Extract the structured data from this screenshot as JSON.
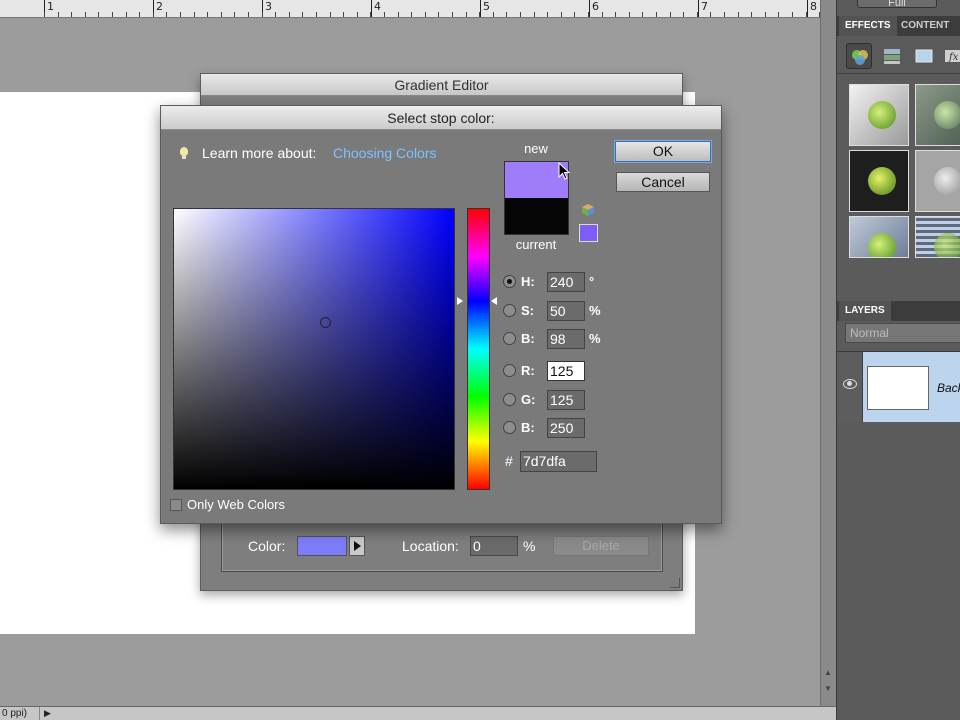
{
  "ruler": {
    "labels": [
      "1",
      "2",
      "3",
      "4",
      "5",
      "6",
      "7",
      "8"
    ]
  },
  "status": {
    "zoom_text": "0 ppi)"
  },
  "panel": {
    "full_label": "Full",
    "tabs": {
      "effects": "EFFECTS",
      "content": "CONTENT"
    },
    "layers_tab": "LAYERS",
    "blend_mode": "Normal",
    "layer_name": "Backgr"
  },
  "gradient_editor": {
    "title": "Gradient Editor",
    "color_label": "Color:",
    "location_label": "Location:",
    "location_value": "0",
    "location_unit": "%",
    "delete_label": "Delete"
  },
  "color_dialog": {
    "title": "Select stop color:",
    "learn_text": "Learn more about:",
    "learn_link": "Choosing Colors",
    "new_label": "new",
    "current_label": "current",
    "ok_label": "OK",
    "cancel_label": "Cancel",
    "only_web_colors": "Only Web Colors",
    "fields": {
      "h": {
        "label": "H:",
        "value": "240",
        "unit": "°"
      },
      "s": {
        "label": "S:",
        "value": "50",
        "unit": "%"
      },
      "b": {
        "label": "B:",
        "value": "98",
        "unit": "%"
      },
      "r": {
        "label": "R:",
        "value": "125"
      },
      "g": {
        "label": "G:",
        "value": "125"
      },
      "bl": {
        "label": "B:",
        "value": "250"
      }
    },
    "hash_label": "#",
    "hex_value": "7d7dfa"
  },
  "colors": {
    "new_color": "#9f7dfa",
    "current_color": "#050505",
    "selected_color": "#7d7dfa",
    "link_color": "#7ec2ff"
  }
}
